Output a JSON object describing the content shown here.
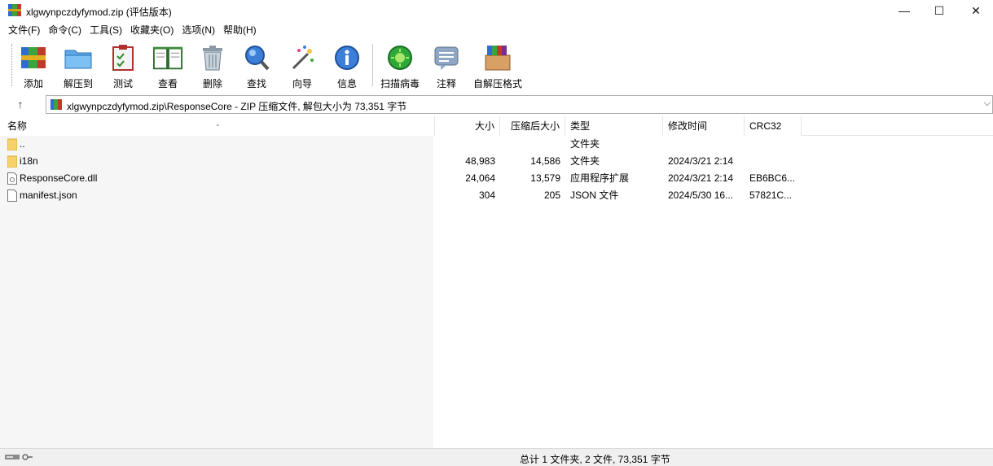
{
  "window": {
    "title": "xlgwynpczdyfymod.zip (评估版本)",
    "minimize": "—",
    "maximize": "☐",
    "close": "✕"
  },
  "menu": [
    "文件(F)",
    "命令(C)",
    "工具(S)",
    "收藏夹(O)",
    "选项(N)",
    "帮助(H)"
  ],
  "toolbar": {
    "add": "添加",
    "extract": "解压到",
    "test": "测试",
    "view": "查看",
    "delete": "删除",
    "find": "查找",
    "wizard": "向导",
    "info": "信息",
    "scan": "扫描病毒",
    "comment": "注释",
    "sfx": "自解压格式"
  },
  "address": {
    "up": "↑",
    "path": "xlgwynpczdyfymod.zip\\ResponseCore - ZIP 压缩文件, 解包大小为 73,351 字节",
    "dropdown": "⌵"
  },
  "columns": {
    "name": "名称",
    "size": "大小",
    "packed": "压缩后大小",
    "type": "类型",
    "modified": "修改时间",
    "crc": "CRC32"
  },
  "files": [
    {
      "name": "..",
      "size": "",
      "packed": "",
      "type": "文件夹",
      "modified": "",
      "crc": "",
      "icon": "folder-icon"
    },
    {
      "name": "i18n",
      "size": "48,983",
      "packed": "14,586",
      "type": "文件夹",
      "modified": "2024/3/21 2:14",
      "crc": "",
      "icon": "folder-icon"
    },
    {
      "name": "ResponseCore.dll",
      "size": "24,064",
      "packed": "13,579",
      "type": "应用程序扩展",
      "modified": "2024/3/21 2:14",
      "crc": "EB6BC6...",
      "icon": "dll-file-icon"
    },
    {
      "name": "manifest.json",
      "size": "304",
      "packed": "205",
      "type": "JSON 文件",
      "modified": "2024/5/30 16...",
      "crc": "57821C...",
      "icon": "file-icon"
    }
  ],
  "status": {
    "summary": "总计 1 文件夹, 2 文件, 73,351 字节"
  }
}
